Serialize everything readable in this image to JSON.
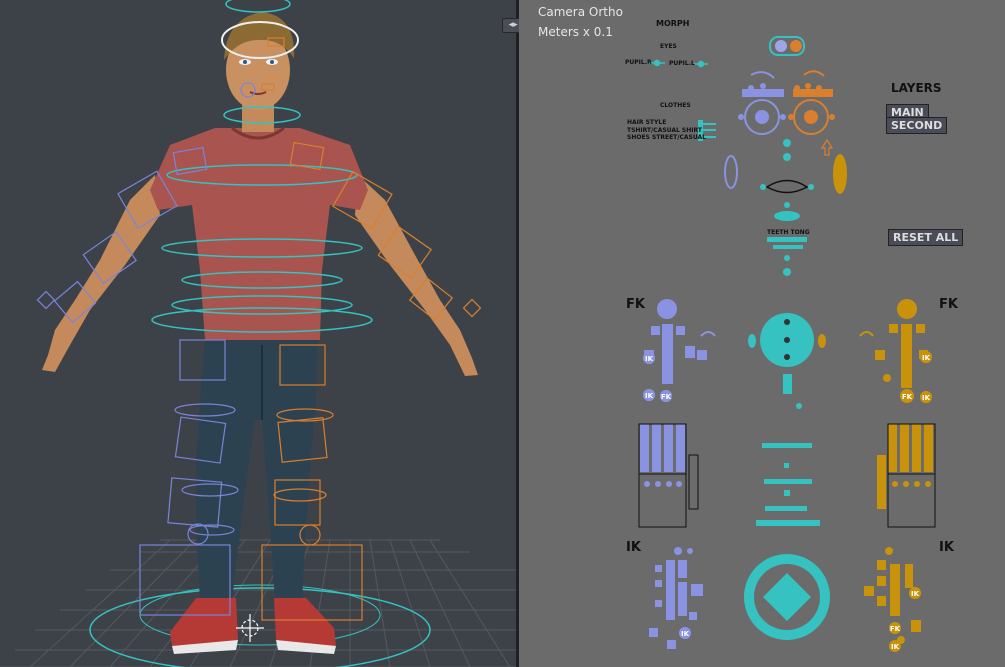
{
  "viewport_right": {
    "camera_label": "Camera Ortho",
    "units_label": "Meters x 0.1",
    "labels": {
      "morph": "MORPH",
      "eyes": "EYES",
      "pupil_r": "PUPIL.R",
      "pupil_l": "PUPIL.L",
      "clothes": "CLOTHES",
      "hair_style": "HAIR STYLE",
      "shirt": "TSHIRT/CASUAL SHIRT",
      "shoes": "SHOES STREET/CASUAL",
      "teeth_tong": "TEETH  TONG",
      "layers": "LAYERS",
      "fk_left": "FK",
      "fk_right": "FK",
      "ik_left": "IK",
      "ik_right": "IK",
      "ik_badge": "IK",
      "fk_badge": "FK"
    },
    "buttons": {
      "main": "MAIN",
      "second": "SECOND",
      "reset_all": "RESET ALL"
    }
  },
  "split_widget": "◂▸ ◈",
  "colors": {
    "rig_blue": "#7a84d8",
    "rig_orange": "#d97f2e",
    "rig_cyan": "#35c2c0",
    "gold": "#c8930a",
    "viewport_bg": "#3d4249",
    "picker_bg": "#6b6b6b"
  }
}
